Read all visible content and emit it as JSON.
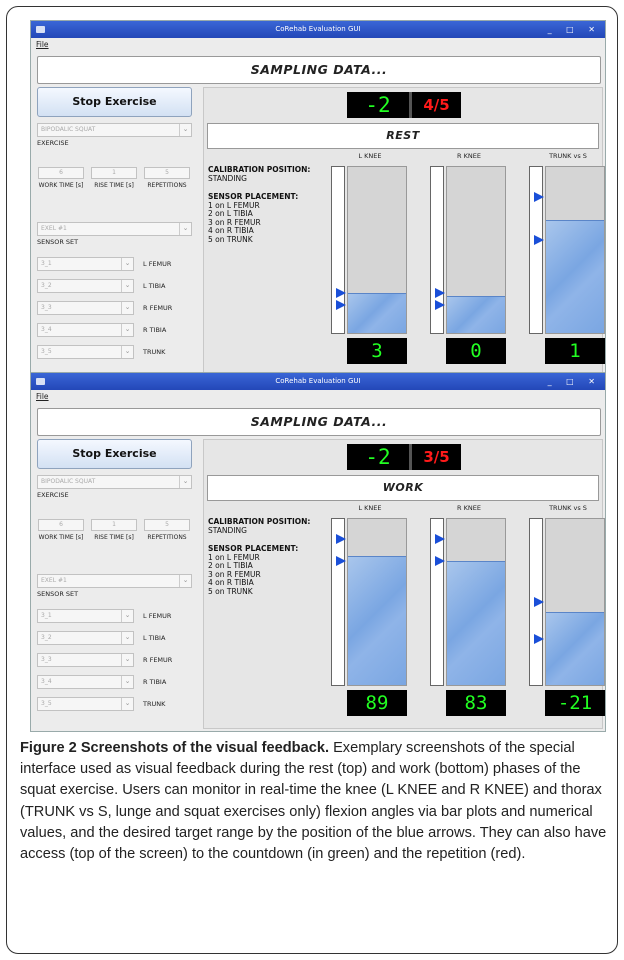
{
  "windows": [
    {
      "title": "CoRehab Evaluation GUI",
      "controls": "_ □ ✕",
      "menu_file": "File",
      "status_banner": "SAMPLING DATA...",
      "stop_button": "Stop Exercise",
      "exercise_value": "BIPODALIC SQUAT",
      "exercise_label": "EXERCISE",
      "work_time": "6",
      "rise_time": "1",
      "repetitions": "5",
      "work_time_label": "WORK TIME [s]",
      "rise_time_label": "RISE TIME [s]",
      "repetitions_label": "REPETITIONS",
      "sensor_set_value": "EXEL #1",
      "sensor_set_label": "SENSOR SET",
      "sensors": [
        {
          "value": "3_1",
          "label": "L FEMUR"
        },
        {
          "value": "3_2",
          "label": "L TIBIA"
        },
        {
          "value": "3_3",
          "label": "R FEMUR"
        },
        {
          "value": "3_4",
          "label": "R TIBIA"
        },
        {
          "value": "3_5",
          "label": "TRUNK"
        }
      ],
      "countdown": "-2",
      "repetition": "4/5",
      "phase": "REST",
      "calibration_heading": "CALIBRATION POSITION:",
      "calibration_value": "STANDING",
      "placement_heading": "SENSOR PLACEMENT:",
      "placement_lines": [
        "1 on L FEMUR",
        "2 on L TIBIA",
        "3 on R FEMUR",
        "4 on R TIBIA",
        "5 on TRUNK"
      ],
      "gauges": [
        {
          "label": "L KNEE",
          "value": "3",
          "fill_fraction": 0.24,
          "arrows": [
            0.24,
            0.17
          ]
        },
        {
          "label": "R KNEE",
          "value": "0",
          "fill_fraction": 0.22,
          "arrows": [
            0.24,
            0.17
          ]
        },
        {
          "label": "TRUNK vs S",
          "value": "1",
          "fill_fraction": 0.68,
          "arrows": [
            0.82,
            0.56
          ]
        }
      ]
    },
    {
      "title": "CoRehab Evaluation GUI",
      "controls": "_ □ ✕",
      "menu_file": "File",
      "status_banner": "SAMPLING DATA...",
      "stop_button": "Stop Exercise",
      "exercise_value": "BIPODALIC SQUAT",
      "exercise_label": "EXERCISE",
      "work_time": "6",
      "rise_time": "1",
      "repetitions": "5",
      "work_time_label": "WORK TIME [s]",
      "rise_time_label": "RISE TIME [s]",
      "repetitions_label": "REPETITIONS",
      "sensor_set_value": "EXEL #1",
      "sensor_set_label": "SENSOR SET",
      "sensors": [
        {
          "value": "3_1",
          "label": "L FEMUR"
        },
        {
          "value": "3_2",
          "label": "L TIBIA"
        },
        {
          "value": "3_3",
          "label": "R FEMUR"
        },
        {
          "value": "3_4",
          "label": "R TIBIA"
        },
        {
          "value": "3_5",
          "label": "TRUNK"
        }
      ],
      "countdown": "-2",
      "repetition": "3/5",
      "phase": "WORK",
      "calibration_heading": "CALIBRATION POSITION:",
      "calibration_value": "STANDING",
      "placement_heading": "SENSOR PLACEMENT:",
      "placement_lines": [
        "1 on L FEMUR",
        "2 on L TIBIA",
        "3 on R FEMUR",
        "4 on R TIBIA",
        "5 on TRUNK"
      ],
      "gauges": [
        {
          "label": "L KNEE",
          "value": "89",
          "fill_fraction": 0.78,
          "arrows": [
            0.88,
            0.75
          ]
        },
        {
          "label": "R KNEE",
          "value": "83",
          "fill_fraction": 0.75,
          "arrows": [
            0.88,
            0.75
          ]
        },
        {
          "label": "TRUNK vs S",
          "value": "-21",
          "fill_fraction": 0.44,
          "arrows": [
            0.5,
            0.28
          ]
        }
      ]
    }
  ],
  "caption": {
    "title": "Figure 2 Screenshots of the visual feedback.",
    "body": "Exemplary screenshots of the special interface used as visual feedback during the rest (top) and work (bottom) phases of the squat exercise. Users can monitor in real-time the knee (L KNEE and R KNEE) and thorax (TRUNK vs S, lunge and squat exercises only) flexion angles via bar plots and numerical values, and the desired target range by the position of the blue arrows. They can also have access (top of the screen) to the countdown (in green) and the repetition (red)."
  },
  "colors": {
    "countdown": "#22ff22",
    "repetition": "#ff1a1a",
    "arrow": "#1a4fd8",
    "bar_fill": "#7aa6e2",
    "titlebar": "#2f58c9"
  }
}
